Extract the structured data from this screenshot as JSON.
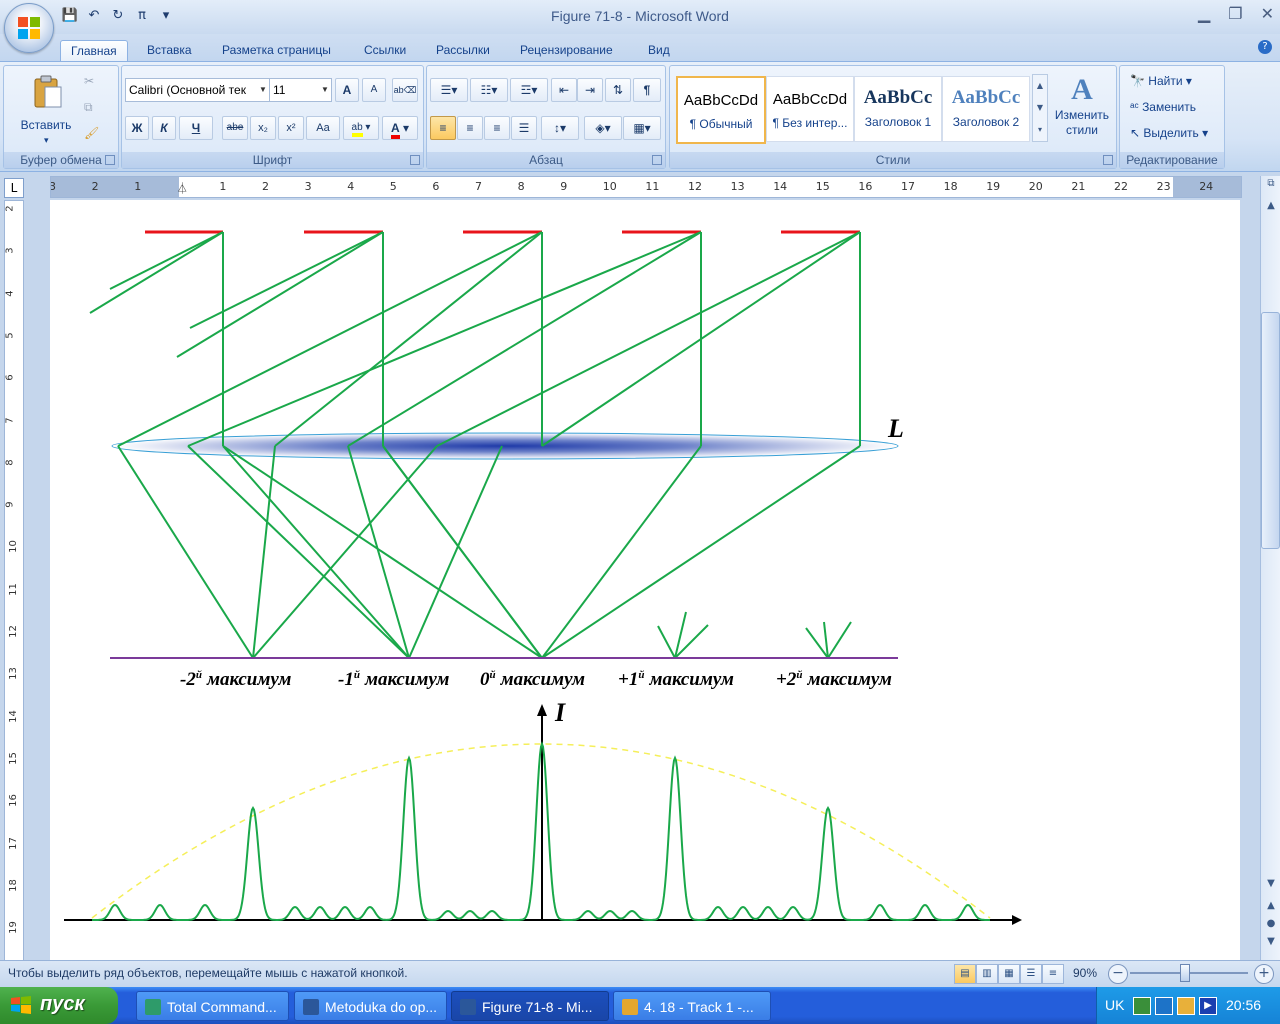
{
  "window": {
    "title": "Figure 71-8 - Microsoft Word"
  },
  "qat": {
    "save": "💾",
    "undo": "↶",
    "redo": "↻",
    "pi": "π",
    "more": "▾"
  },
  "tabs": [
    "Главная",
    "Вставка",
    "Разметка страницы",
    "Ссылки",
    "Рассылки",
    "Рецензирование",
    "Вид"
  ],
  "ribbon": {
    "clipboard": {
      "paste": "Вставить",
      "group": "Буфер обмена"
    },
    "font": {
      "name": "Calibri (Основной тек",
      "size": "11",
      "group": "Шрифт",
      "grow": "A",
      "shrink": "A",
      "bold": "Ж",
      "italic": "К",
      "underline": "Ч",
      "strike": "abe",
      "sub": "x₂",
      "sup": "x²",
      "case": "Aa"
    },
    "paragraph": {
      "group": "Абзац",
      "pilcrow": "¶"
    },
    "styles": {
      "group": "Стили",
      "items": [
        {
          "sample": "AaBbCcDd",
          "name": "¶ Обычный"
        },
        {
          "sample": "AaBbCcDd",
          "name": "¶ Без интер..."
        },
        {
          "sample": "AaBbCc",
          "name": "Заголовок 1"
        },
        {
          "sample": "AaBbCc",
          "name": "Заголовок 2"
        }
      ],
      "change": "Изменить стили"
    },
    "editing": {
      "group": "Редактирование",
      "find": "Найти",
      "replace": "Заменить",
      "select": "Выделить"
    }
  },
  "ruler": {
    "tab_selector": "L",
    "labels": [
      "3",
      "2",
      "1",
      "",
      "1",
      "2",
      "3",
      "4",
      "5",
      "6",
      "7",
      "8",
      "9",
      "10",
      "11",
      "12",
      "13",
      "14",
      "15",
      "16",
      "17",
      "18",
      "19",
      "20",
      "21",
      "22",
      "23",
      "24"
    ],
    "vlabels": [
      "2",
      "3",
      "4",
      "5",
      "6",
      "7",
      "8",
      "9",
      "10",
      "11",
      "12",
      "13",
      "14",
      "15",
      "16",
      "17",
      "18",
      "19"
    ]
  },
  "figure": {
    "lens_label": "L",
    "intensity_label": "I",
    "maxima": [
      {
        "num": "-2",
        "sup": "й",
        "word": "максимум"
      },
      {
        "num": "-1",
        "sup": "й",
        "word": "максимум"
      },
      {
        "num": "0",
        "sup": "й",
        "word": "максимум"
      },
      {
        "num": "+1",
        "sup": "й",
        "word": "максимум"
      },
      {
        "num": "+2",
        "sup": "й",
        "word": "максимум"
      }
    ],
    "colors": {
      "slit": "#e8141b",
      "ray": "#1aa84a",
      "screen": "#7b3a9a",
      "envelope": "#f5ef5a",
      "lens_edge": "#3aa0d6"
    }
  },
  "status": {
    "text": "Чтобы выделить ряд объектов, перемещайте мышь с нажатой кнопкой.",
    "zoom": "90%"
  },
  "taskbar": {
    "start": "пуск",
    "tasks": [
      "Total Command...",
      "Metoduka do op...",
      "Figure 71-8 - Mi...",
      "4. 18 - Track 1 -..."
    ],
    "lang": "UK",
    "clock": "20:56"
  }
}
